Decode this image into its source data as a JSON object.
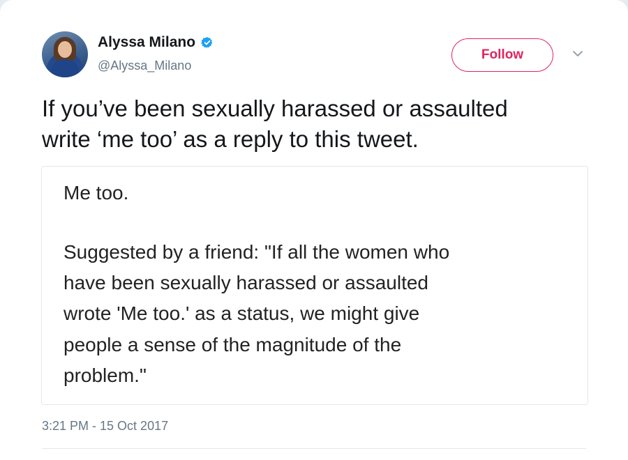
{
  "tweet": {
    "author": {
      "display_name": "Alyssa Milano",
      "handle": "@Alyssa_Milano",
      "verified": true
    },
    "follow_label": "Follow",
    "text_lines": [
      "If you’ve been sexually harassed or assaulted",
      "write ‘me too’ as a reply to this tweet."
    ],
    "media": {
      "lines": [
        "Me too.",
        "Suggested by a friend: \"If all the women who",
        "have been sexually harassed or assaulted",
        "wrote 'Me too.' as a status, we might give",
        "people a sense of the magnitude of the",
        "problem.\""
      ]
    },
    "timestamp": "3:21 PM - 15 Oct 2017"
  },
  "icons": {
    "verified": "verified-badge-icon",
    "menu": "chevron-down-icon"
  },
  "colors": {
    "follow_accent": "#e0245e",
    "verified_blue": "#1da1f2",
    "secondary_text": "#657786"
  }
}
